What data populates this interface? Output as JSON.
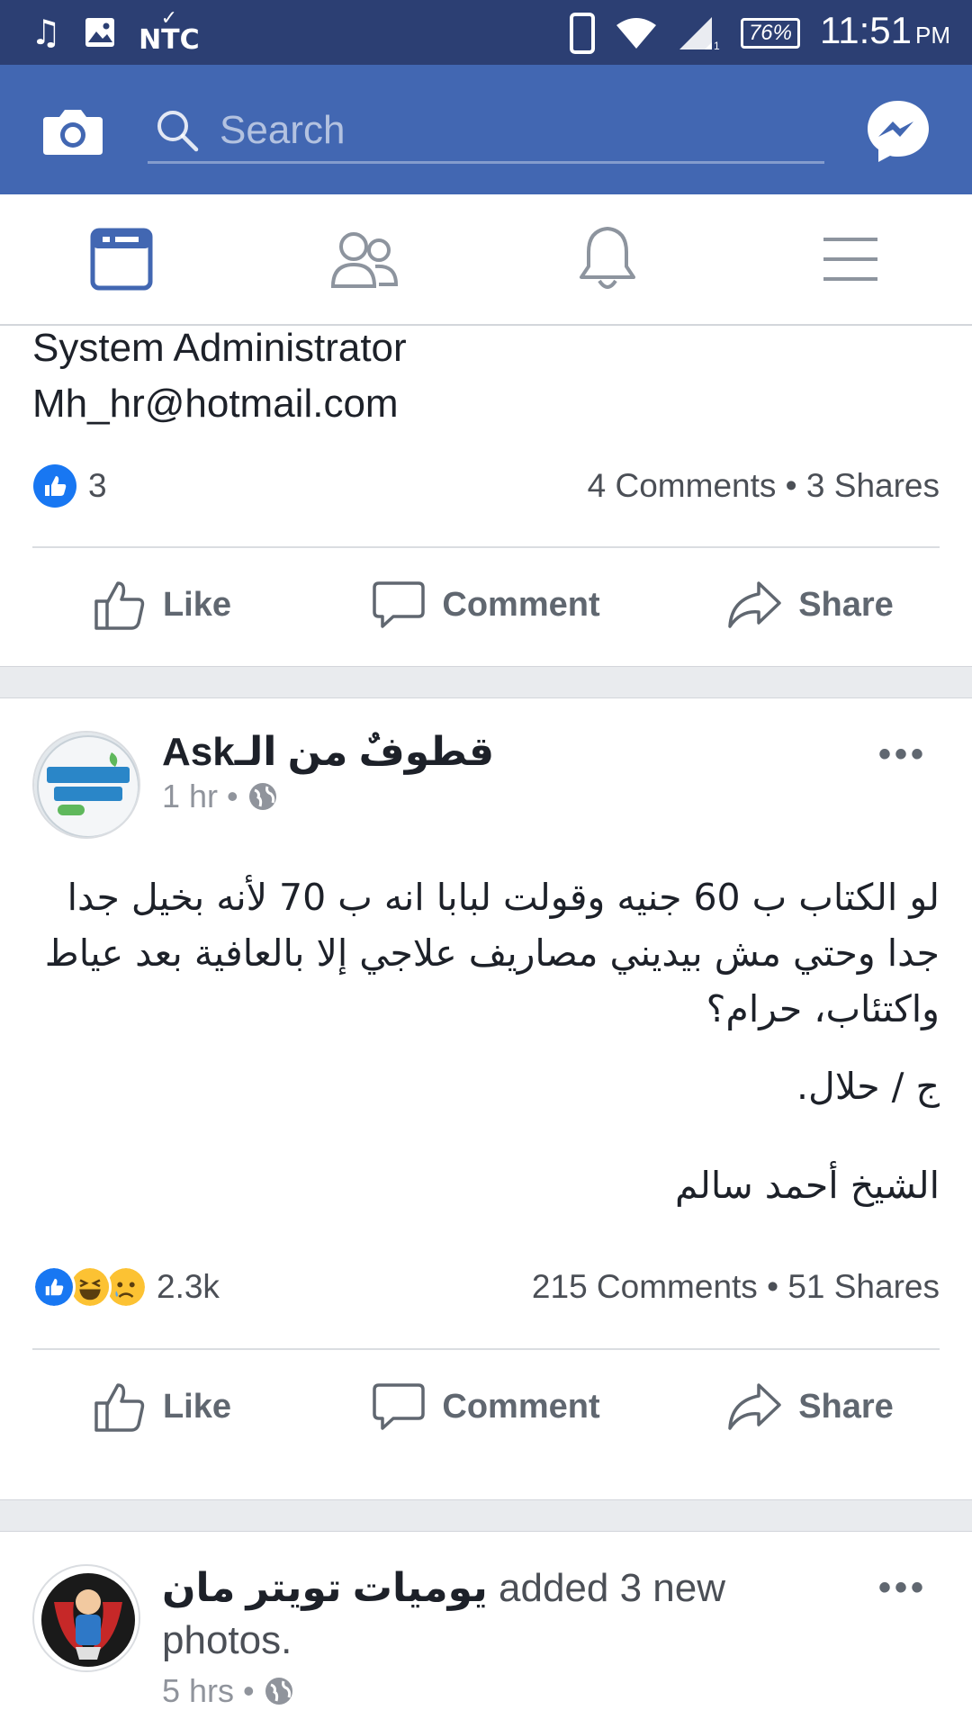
{
  "status_bar": {
    "carrier": "NTC",
    "battery": "76%",
    "time": "11:51",
    "ampm": "PM",
    "icons": [
      "music-note-icon",
      "image-icon",
      "nike-swoosh-icon",
      "phone-icon",
      "wifi-icon",
      "signal-icon",
      "battery-icon"
    ]
  },
  "header": {
    "search_placeholder": "Search",
    "icons": [
      "camera-icon",
      "search-icon",
      "messenger-icon"
    ]
  },
  "nav": {
    "tabs": [
      {
        "name": "news-feed",
        "icon": "news-feed-icon",
        "active": true
      },
      {
        "name": "friends",
        "icon": "friends-icon",
        "active": false
      },
      {
        "name": "notifications",
        "icon": "bell-icon",
        "active": false
      },
      {
        "name": "menu",
        "icon": "menu-icon",
        "active": false
      }
    ]
  },
  "colors": {
    "brand": "#4267b2",
    "status_bar": "#2c3f73",
    "like_blue": "#1877f2",
    "text": "#1d2129",
    "muted": "#90949c"
  },
  "post1": {
    "text_line1": "System Administrator",
    "text_line2": "Mh_hr@hotmail.com",
    "reaction_count": "3",
    "comments_shares": "4 Comments • 3 Shares",
    "actions": {
      "like": "Like",
      "comment": "Comment",
      "share": "Share"
    }
  },
  "post2": {
    "author": "قطوفٌ من الـAsk",
    "time": "1 hr",
    "dot": "•",
    "body_paragraph1": "لو الكتاب ب 60 جنيه وقولت لبابا انه ب 70 لأنه بخيل جدا جدا وحتي مش بيديني مصاريف علاجي إلا بالعافية بعد عياط واكتئاب، حرام؟",
    "body_paragraph2": "ج / حلال.",
    "body_paragraph3": "الشيخ أحمد سالم",
    "reaction_count": "2.3k",
    "comments_shares": "215 Comments • 51 Shares",
    "more": "•••",
    "actions": {
      "like": "Like",
      "comment": "Comment",
      "share": "Share"
    }
  },
  "post3": {
    "author": "يوميات تويتر مان",
    "action_text": "added 3 new",
    "action_text2": "photos.",
    "time": "5 hrs",
    "dot": "•",
    "more": "•••"
  }
}
